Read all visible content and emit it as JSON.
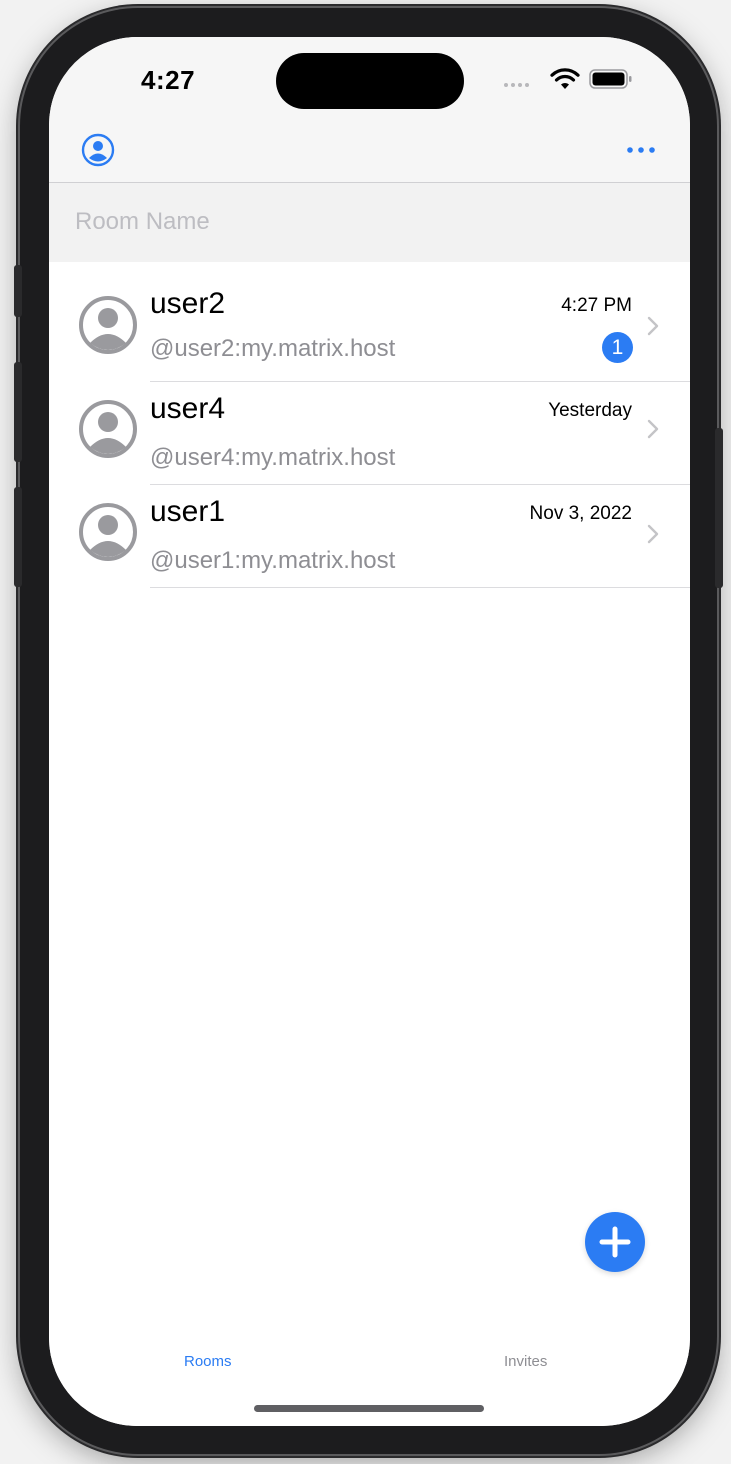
{
  "status_bar": {
    "time": "4:27"
  },
  "search": {
    "placeholder": "Room Name",
    "value": ""
  },
  "rooms": [
    {
      "name": "user2",
      "id": "@user2:my.matrix.host",
      "time": "4:27 PM",
      "unread": "1"
    },
    {
      "name": "user4",
      "id": "@user4:my.matrix.host",
      "time": "Yesterday"
    },
    {
      "name": "user1",
      "id": "@user1:my.matrix.host",
      "time": "Nov 3, 2022"
    }
  ],
  "tabs": {
    "rooms": "Rooms",
    "invites": "Invites"
  },
  "icons": {
    "profile": "person-circle-icon",
    "more": "ellipsis-icon",
    "avatar": "person-avatar-icon",
    "chevron": "chevron-right-icon",
    "compose": "plus-icon"
  },
  "colors": {
    "accent": "#2b7cf3",
    "secondary_text": "#8e8e93",
    "avatar": "#9a9a9e"
  }
}
